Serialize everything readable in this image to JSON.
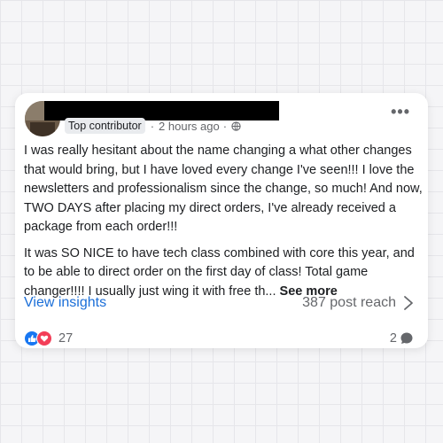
{
  "post": {
    "badge": "Top contributor",
    "separator": "·",
    "time": "2 hours ago",
    "separator2": "·",
    "more_label": "•••",
    "paragraph1": "I was really hesitant about the name changing a what other changes that would bring, but I have loved every change I've seen!!! I love the newsletters and professionalism since the change, so much! And now, TWO DAYS after placing my direct orders, I've already received a package from each order!!!",
    "paragraph2": "It was SO NICE to have tech class combined with core this year, and to be able to direct order on the first day of class! Total game changer!!!! I usually just wing it with free th...",
    "see_more": "See more"
  },
  "insights": {
    "link_label": "View insights",
    "reach": "387 post reach"
  },
  "reactions": {
    "count": "27",
    "comments": "2"
  },
  "colors": {
    "link": "#1a6ed8",
    "like": "#1877f2",
    "love": "#f33e58"
  },
  "icons": [
    "globe-icon",
    "more-icon",
    "chevron-right-icon",
    "like-icon",
    "love-icon",
    "comment-icon"
  ]
}
